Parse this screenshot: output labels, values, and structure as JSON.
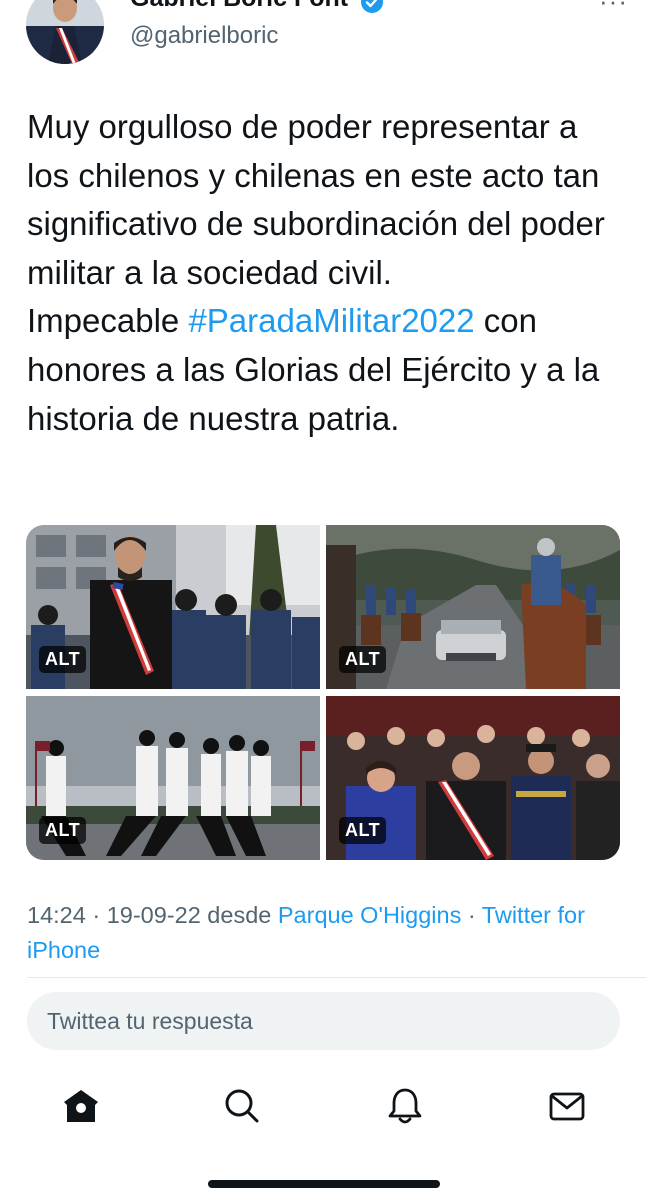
{
  "header": {
    "display_name": "Gabriel Boric Font",
    "handle": "@gabrielboric",
    "more_label": "···"
  },
  "tweet": {
    "text_part1": "Muy orgulloso de poder representar a los chilenos y chilenas en este acto tan significativo de subordinación del poder militar a la sociedad civil.",
    "text_part2_prefix": "Impecable ",
    "hashtag": "#ParadaMilitar2022",
    "text_part2_suffix": " con honores a las Glorias del Ejército y a la historia de nuestra patria."
  },
  "media": {
    "alt_label": "ALT",
    "items": [
      {
        "icon": "photo-president-with-guards"
      },
      {
        "icon": "photo-cavalry-parade-convertible"
      },
      {
        "icon": "photo-marching-cadets"
      },
      {
        "icon": "photo-officials-applauding"
      }
    ]
  },
  "meta": {
    "time": "14:24",
    "sep1": " · ",
    "date": "19-09-22",
    "from": " desde ",
    "location": "Parque O'Higgins",
    "sep2": " · ",
    "source": "Twitter for iPhone"
  },
  "reply": {
    "placeholder": "Twittea tu respuesta"
  },
  "nav": {
    "items": [
      {
        "icon": "home-icon"
      },
      {
        "icon": "search-icon"
      },
      {
        "icon": "bell-icon"
      },
      {
        "icon": "mail-icon"
      }
    ]
  },
  "colors": {
    "accent": "#1d9bf0",
    "text": "#0f1419",
    "secondary": "#536471",
    "reply_bg": "#eff3f4"
  }
}
